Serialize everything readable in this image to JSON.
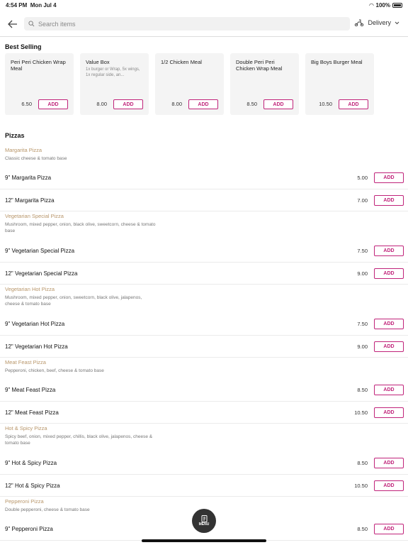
{
  "status": {
    "time": "4:54 PM",
    "date": "Mon Jul 4",
    "battery": "100%"
  },
  "search": {
    "placeholder": "Search items"
  },
  "delivery": {
    "label": "Delivery"
  },
  "best_selling": {
    "title": "Best Selling",
    "items": [
      {
        "name": "Peri Peri Chicken Wrap Meal",
        "desc": "",
        "price": "6.50",
        "add": "ADD"
      },
      {
        "name": "Value Box",
        "desc": "1x burger or Wrap, 5x wings, 1x regular side, an...",
        "price": "8.00",
        "add": "ADD"
      },
      {
        "name": "1/2 Chicken Meal",
        "desc": "",
        "price": "8.00",
        "add": "ADD"
      },
      {
        "name": "Double Peri Peri Chicken Wrap Meal",
        "desc": "",
        "price": "8.50",
        "add": "ADD"
      },
      {
        "name": "Big Boys Burger Meal",
        "desc": "",
        "price": "10.50",
        "add": "ADD"
      }
    ]
  },
  "pizzas": {
    "title": "Pizzas",
    "categories": [
      {
        "name": "Margarita Pizza",
        "desc": "Classic cheese & tomato base",
        "items": [
          {
            "name": "9\" Margarita Pizza",
            "price": "5.00",
            "add": "ADD"
          },
          {
            "name": "12\" Margarita Pizza",
            "price": "7.00",
            "add": "ADD"
          }
        ]
      },
      {
        "name": "Vegetarian Special Pizza",
        "desc": "Mushroom, mixed pepper, onion, black olive, sweetcorn, cheese & tomato base",
        "items": [
          {
            "name": "9\" Vegetarian Special Pizza",
            "price": "7.50",
            "add": "ADD"
          },
          {
            "name": "12\" Vegetarian Special Pizza",
            "price": "9.00",
            "add": "ADD"
          }
        ]
      },
      {
        "name": "Vegetarian Hot Pizza",
        "desc": "Mushroom, mixed pepper, onion, sweetcorn, black olive, jalapenos, cheese & tomato base",
        "items": [
          {
            "name": "9\" Vegetarian Hot Pizza",
            "price": "7.50",
            "add": "ADD"
          },
          {
            "name": "12\" Vegetarian Hot Pizza",
            "price": "9.00",
            "add": "ADD"
          }
        ]
      },
      {
        "name": "Meat Feast Pizza",
        "desc": "Pepperoni, chicken, beef, cheese & tomato base",
        "items": [
          {
            "name": "9\" Meat Feast Pizza",
            "price": "8.50",
            "add": "ADD"
          },
          {
            "name": "12\" Meat Feast Pizza",
            "price": "10.50",
            "add": "ADD"
          }
        ]
      },
      {
        "name": "Hot & Spicy Pizza",
        "desc": "Spicy beef, onion, mixed pepper, chillis, black olive, jalapenos, cheese & tomato base",
        "items": [
          {
            "name": "9\" Hot & Spicy Pizza",
            "price": "8.50",
            "add": "ADD"
          },
          {
            "name": "12\" Hot & Spicy Pizza",
            "price": "10.50",
            "add": "ADD"
          }
        ]
      },
      {
        "name": "Pepperoni Pizza",
        "desc": "Double pepperoni, cheese & tomato base",
        "items": [
          {
            "name": "9\" Pepperoni Pizza",
            "price": "8.50",
            "add": "ADD"
          }
        ]
      }
    ]
  },
  "menu_button": {
    "label": "MENU"
  },
  "colors": {
    "accent": "#c0237a",
    "category": "#b8966a"
  }
}
